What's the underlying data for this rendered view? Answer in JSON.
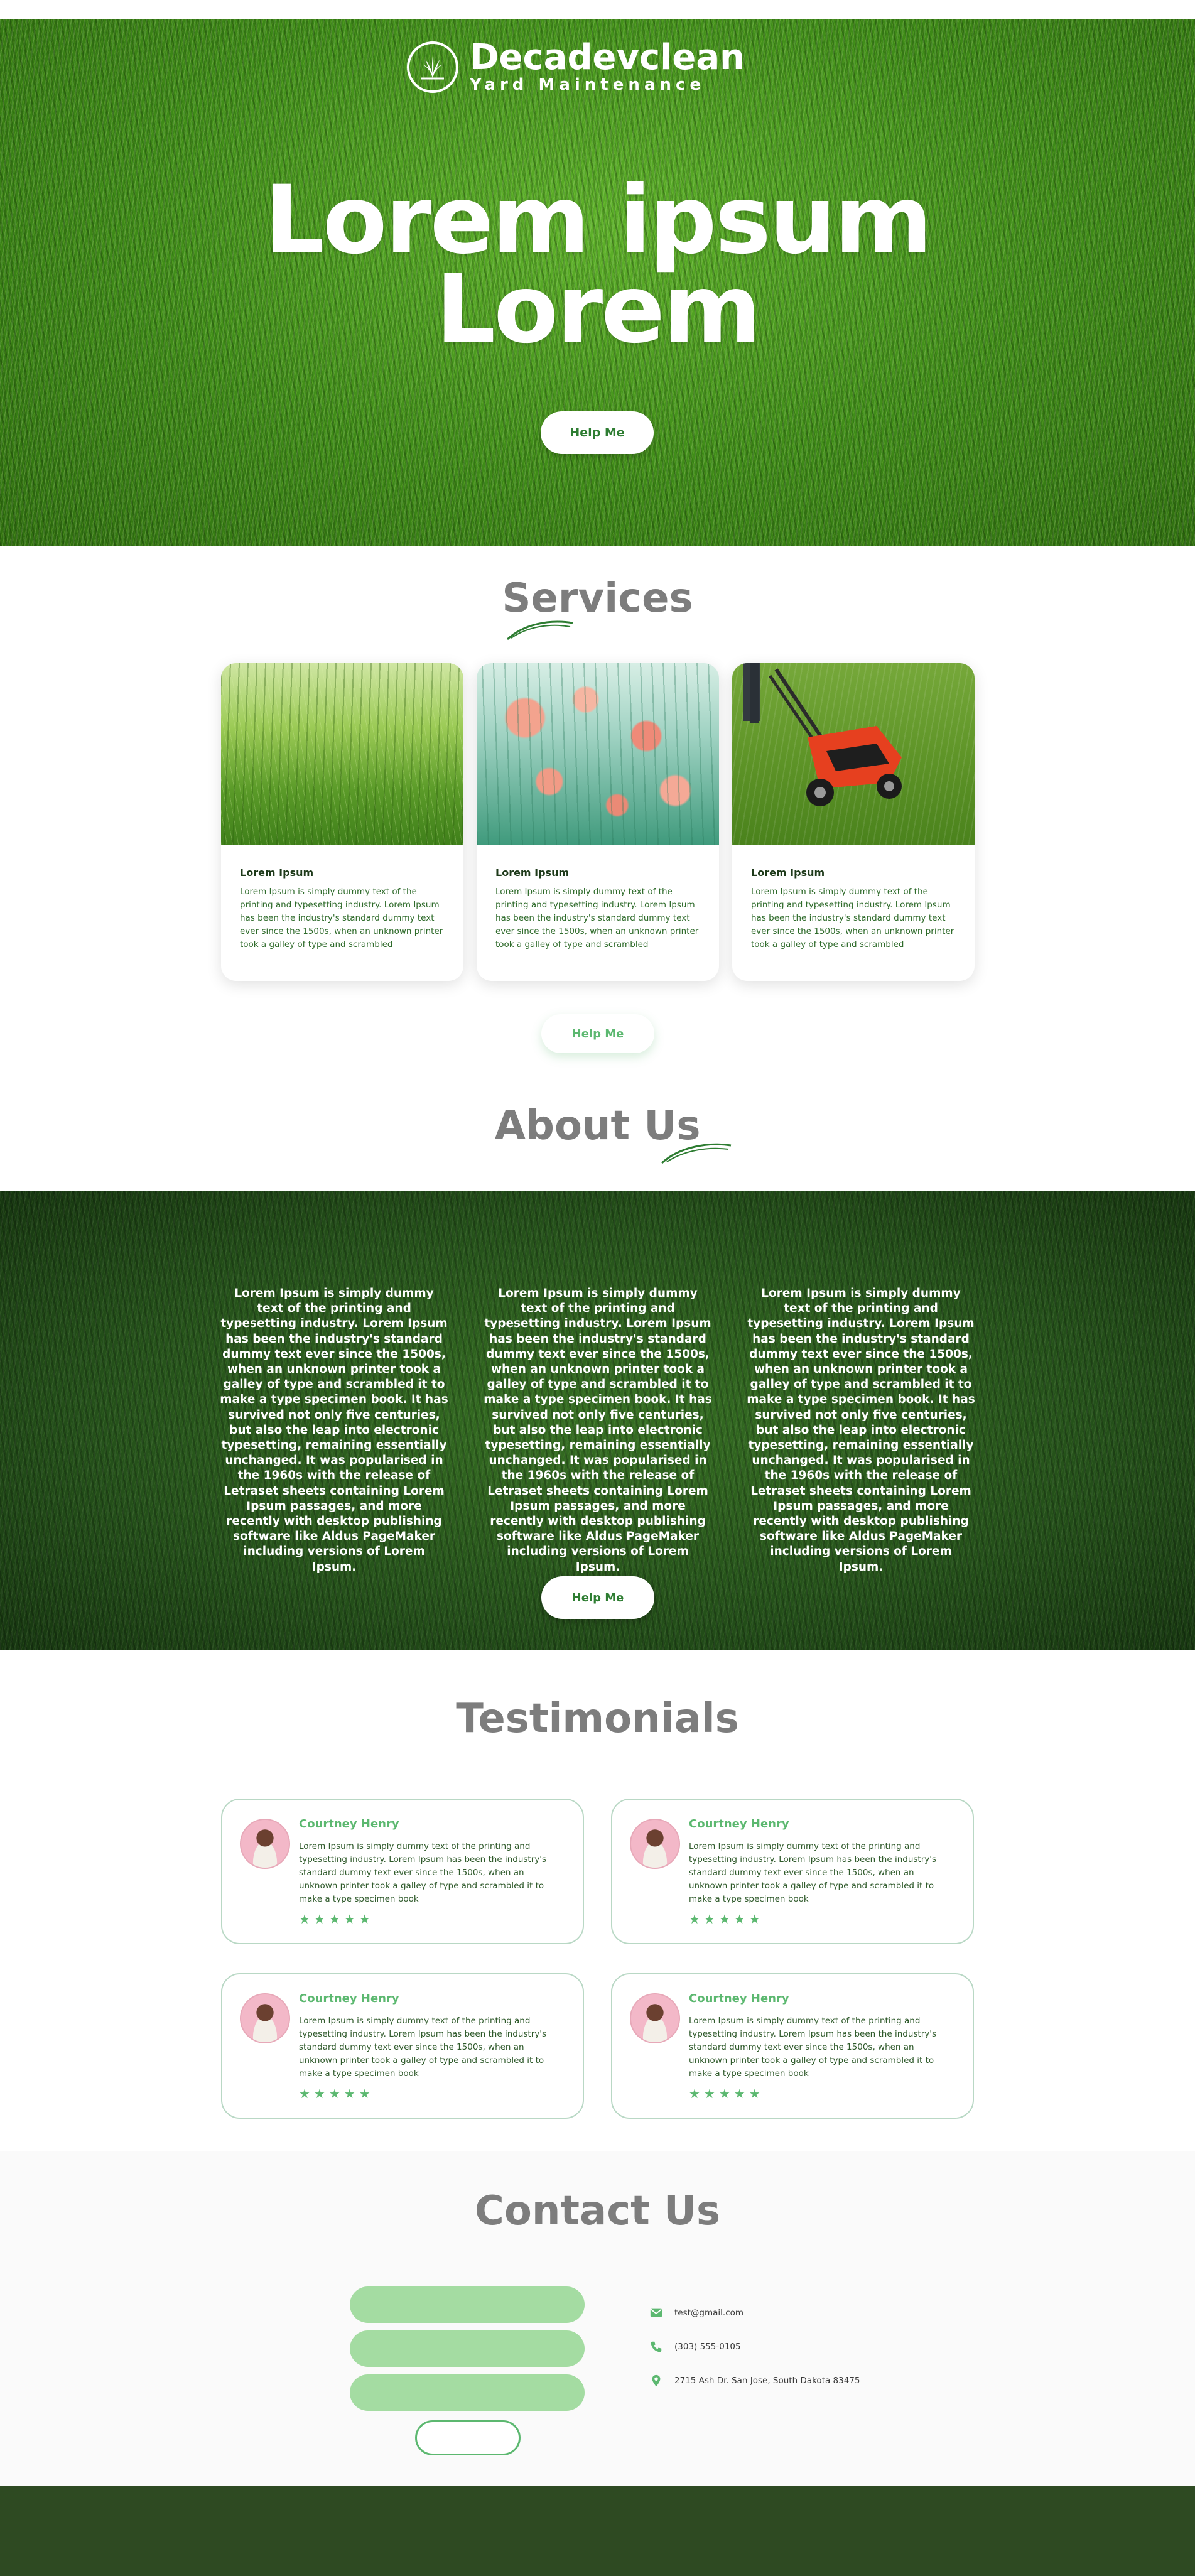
{
  "brand": {
    "name": "Decadevclean",
    "tagline": "Yard Maintenance"
  },
  "hero": {
    "title_line1": "Lorem ipsum",
    "title_line2": "Lorem",
    "button": "Help Me"
  },
  "services": {
    "heading": "Services",
    "cards": [
      {
        "title": "Lorem Ipsum",
        "text": "Lorem Ipsum is simply dummy text of the printing and typesetting industry. Lorem Ipsum has been the industry's standard dummy text ever since the 1500s, when an unknown printer took a galley of type and scrambled"
      },
      {
        "title": "Lorem Ipsum",
        "text": "Lorem Ipsum is simply dummy text of the printing and typesetting industry. Lorem Ipsum has been the industry's standard dummy text ever since the 1500s, when an unknown printer took a galley of type and scrambled"
      },
      {
        "title": "Lorem Ipsum",
        "text": "Lorem Ipsum is simply dummy text of the printing and typesetting industry. Lorem Ipsum has been the industry's standard dummy text ever since the 1500s, when an unknown printer took a galley of type and scrambled"
      }
    ],
    "button": "Help Me"
  },
  "about": {
    "heading": "About Us",
    "columns": [
      "Lorem Ipsum is simply dummy text of the printing and typesetting industry. Lorem Ipsum has been the industry's standard dummy text ever since the 1500s, when an unknown printer took a galley of type and scrambled it to make a type specimen book. It has survived not only five centuries, but also the leap into electronic typesetting, remaining essentially unchanged. It was popularised in the 1960s with the release of Letraset sheets containing Lorem Ipsum passages, and more recently with desktop publishing software like Aldus PageMaker including versions of Lorem Ipsum.",
      "Lorem Ipsum is simply dummy text of the printing and typesetting industry. Lorem Ipsum has been the industry's standard dummy text ever since the 1500s, when an unknown printer took a galley of type and scrambled it to make a type specimen book. It has survived not only five centuries, but also the leap into electronic typesetting, remaining essentially unchanged. It was popularised in the 1960s with the release of Letraset sheets containing Lorem Ipsum passages, and more recently with desktop publishing software like Aldus PageMaker including versions of Lorem Ipsum.",
      "Lorem Ipsum is simply dummy text of the printing and typesetting industry. Lorem Ipsum has been the industry's standard dummy text ever since the 1500s, when an unknown printer took a galley of type and scrambled it to make a type specimen book. It has survived not only five centuries, but also the leap into electronic typesetting, remaining essentially unchanged. It was popularised in the 1960s with the release of Letraset sheets containing Lorem Ipsum passages, and more recently with desktop publishing software like Aldus PageMaker including versions of Lorem Ipsum."
    ],
    "button": "Help Me"
  },
  "testimonials": {
    "heading": "Testimonials",
    "items": [
      {
        "name": "Courtney Henry",
        "text": "Lorem Ipsum is simply dummy text of the printing and typesetting industry. Lorem Ipsum has been the industry's standard dummy text ever since the 1500s, when an unknown printer took a galley of type and scrambled it to make a type specimen book",
        "stars": "★★★★★"
      },
      {
        "name": "Courtney Henry",
        "text": "Lorem Ipsum is simply dummy text of the printing and typesetting industry. Lorem Ipsum has been the industry's standard dummy text ever since the 1500s, when an unknown printer took a galley of type and scrambled it to make a type specimen book",
        "stars": "★★★★★"
      },
      {
        "name": "Courtney Henry",
        "text": "Lorem Ipsum is simply dummy text of the printing and typesetting industry. Lorem Ipsum has been the industry's standard dummy text ever since the 1500s, when an unknown printer took a galley of type and scrambled it to make a type specimen book",
        "stars": "★★★★★"
      },
      {
        "name": "Courtney Henry",
        "text": "Lorem Ipsum is simply dummy text of the printing and typesetting industry. Lorem Ipsum has been the industry's standard dummy text ever since the 1500s, when an unknown printer took a galley of type and scrambled it to make a type specimen book",
        "stars": "★★★★★"
      }
    ]
  },
  "contact": {
    "heading": "Contact Us",
    "email": "test@gmail.com",
    "phone": "(303) 555-0105",
    "address": "2715 Ash Dr. San Jose, South Dakota 83475",
    "icons": [
      "mail-icon",
      "phone-icon",
      "location-pin-icon"
    ]
  },
  "colors": {
    "accent": "#5cb870",
    "field": "#a4dca2",
    "footer": "#2e4a22",
    "heading": "#7d7d7d"
  }
}
